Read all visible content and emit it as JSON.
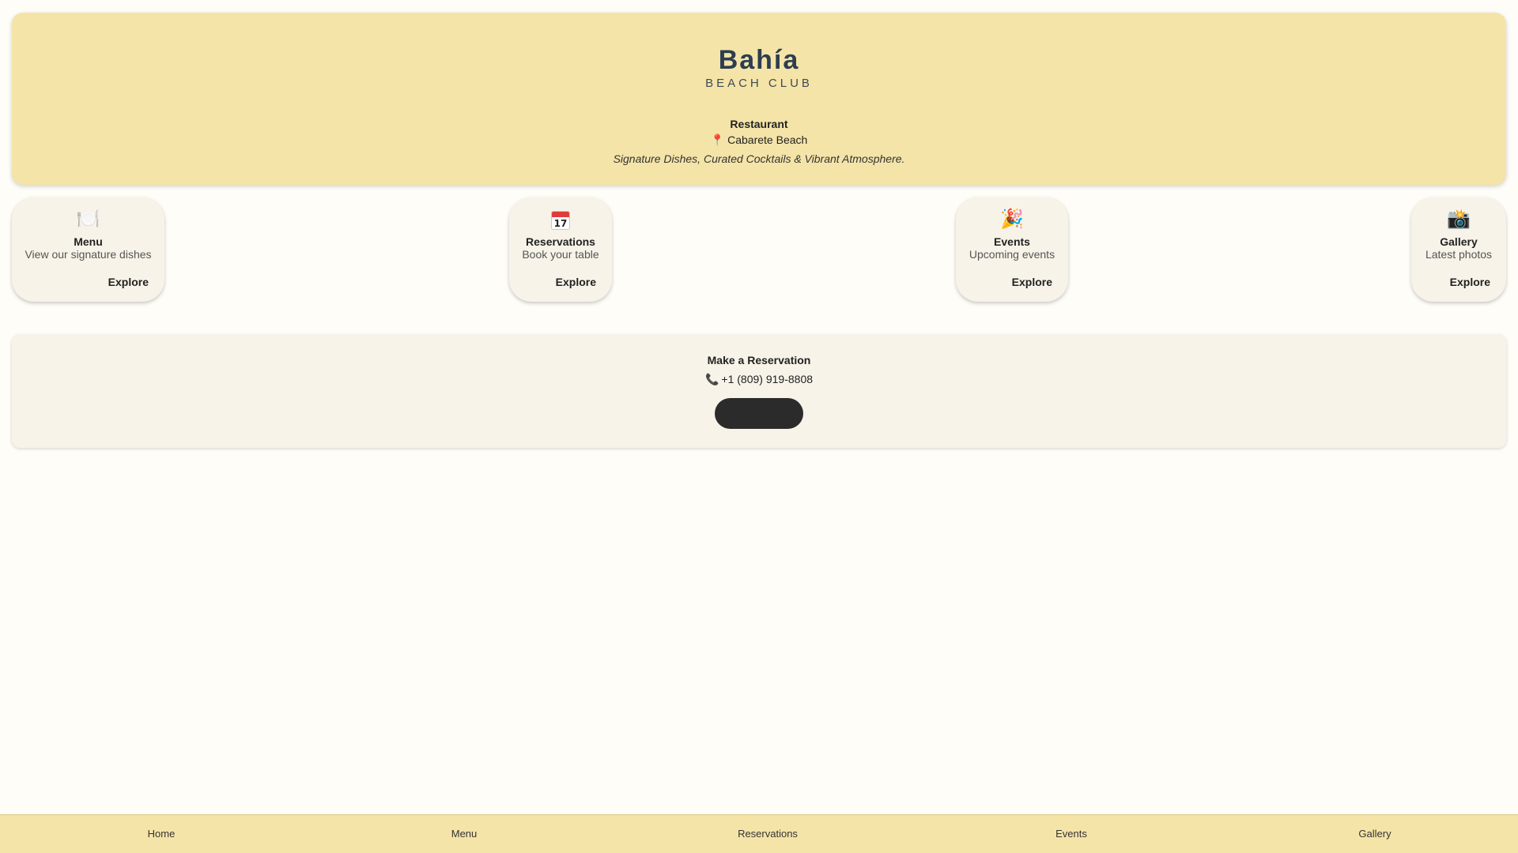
{
  "header": {
    "brand_name": "Bahía",
    "brand_sub": "BEACH CLUB",
    "venue_type": "Restaurant",
    "location": "Cabarete Beach",
    "tagline": "Signature Dishes, Curated Cocktails & Vibrant Atmosphere."
  },
  "cards": [
    {
      "icon": "🍽️",
      "icon_name": "plate-cutlery-icon",
      "title": "Menu",
      "desc": "View our signature dishes",
      "link": "Explore"
    },
    {
      "icon": "17",
      "icon_name": "calendar-icon",
      "title": "Reservations",
      "desc": "Book your table",
      "link": "Explore"
    },
    {
      "icon": "🎉",
      "icon_name": "party-popper-icon",
      "title": "Events",
      "desc": "Upcoming events",
      "link": "Explore"
    },
    {
      "icon": "📸",
      "icon_name": "camera-icon",
      "title": "Gallery",
      "desc": "Latest photos",
      "link": "Explore"
    }
  ],
  "reservation": {
    "title": "Make a Reservation",
    "phone": "+1 (809) 919-8808",
    "button_label": ""
  },
  "bottom_nav": [
    "Home",
    "Menu",
    "Reservations",
    "Events",
    "Gallery"
  ],
  "colors": {
    "header_bg": "#f5e4a8",
    "page_bg": "#fefdf8",
    "card_bg": "#f7f3e8",
    "brand_text": "#2c3e50",
    "button_bg": "#2b2b2b"
  }
}
